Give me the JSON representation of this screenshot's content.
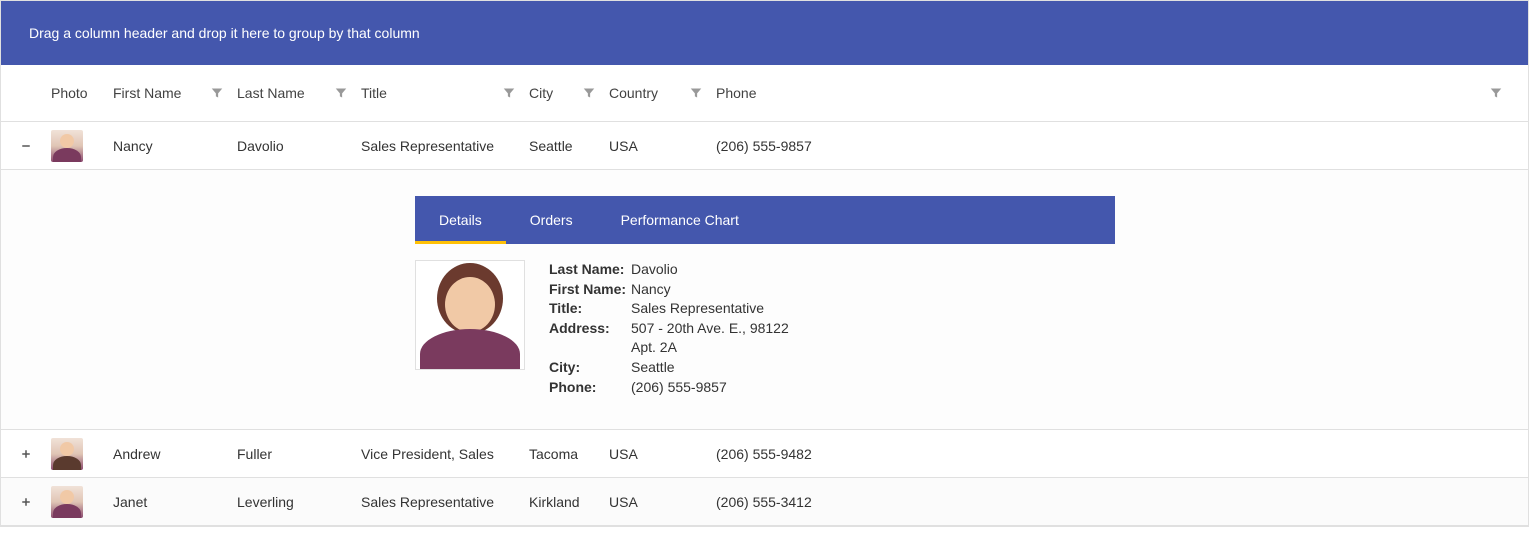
{
  "groupPanel": {
    "hint": "Drag a column header and drop it here to group by that column"
  },
  "columns": {
    "photo": "Photo",
    "firstName": "First Name",
    "lastName": "Last Name",
    "title": "Title",
    "city": "City",
    "country": "Country",
    "phone": "Phone"
  },
  "rows": [
    {
      "expanded": true,
      "firstName": "Nancy",
      "lastName": "Davolio",
      "title": "Sales Representative",
      "city": "Seattle",
      "country": "USA",
      "phone": "(206) 555-9857"
    },
    {
      "expanded": false,
      "firstName": "Andrew",
      "lastName": "Fuller",
      "title": "Vice President, Sales",
      "city": "Tacoma",
      "country": "USA",
      "phone": "(206) 555-9482"
    },
    {
      "expanded": false,
      "firstName": "Janet",
      "lastName": "Leverling",
      "title": "Sales Representative",
      "city": "Kirkland",
      "country": "USA",
      "phone": "(206) 555-3412"
    }
  ],
  "tabs": {
    "details": "Details",
    "orders": "Orders",
    "performance": "Performance Chart"
  },
  "detail": {
    "labels": {
      "lastName": "Last Name:",
      "firstName": "First Name:",
      "title": "Title:",
      "address": "Address:",
      "city": "City:",
      "phone": "Phone:"
    },
    "values": {
      "lastName": "Davolio",
      "firstName": "Nancy",
      "title": "Sales Representative",
      "address1": "507 - 20th Ave. E., 98122",
      "address2": "Apt. 2A",
      "city": "Seattle",
      "phone": "(206) 555-9857"
    }
  }
}
